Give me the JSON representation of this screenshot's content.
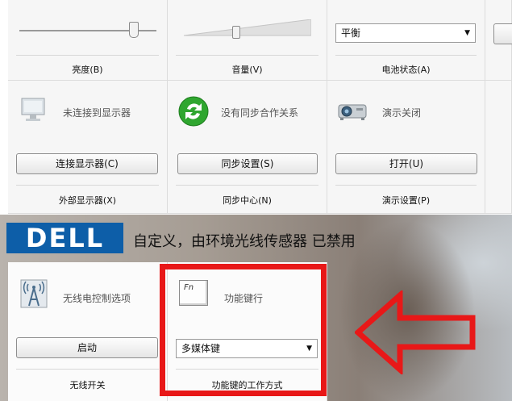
{
  "colors": {
    "dell_blue": "#0d5ea8",
    "highlight_red": "#e81818",
    "tile_bg": "#f6f6f6",
    "sync_green": "#2fa62f"
  },
  "row1": {
    "brightness_label": "亮度(B)",
    "volume_label": "音量(V)",
    "battery": {
      "select_value": "平衡",
      "label": "电池状态(A)"
    }
  },
  "row2": {
    "display": {
      "status": "未连接到显示器",
      "button": "连接显示器(C)",
      "label": "外部显示器(X)",
      "icon": "monitor-icon"
    },
    "sync": {
      "status": "没有同步合作关系",
      "button": "同步设置(S)",
      "label": "同步中心(N)",
      "icon": "sync-icon"
    },
    "presentation": {
      "status": "演示关闭",
      "button": "打开(U)",
      "label": "演示设置(P)",
      "icon": "projector-icon"
    }
  },
  "dell": {
    "logo": "DELL",
    "message": "自定义，由环境光线传感器 已禁用"
  },
  "row3": {
    "wireless": {
      "status": "无线电控制选项",
      "button": "启动",
      "label": "无线开关",
      "icon": "wireless-tower-icon"
    },
    "fnkey": {
      "status": "功能键行",
      "select_value": "多媒体键",
      "label": "功能键的工作方式",
      "icon_text": "Fn",
      "icon": "fn-key-icon"
    }
  }
}
